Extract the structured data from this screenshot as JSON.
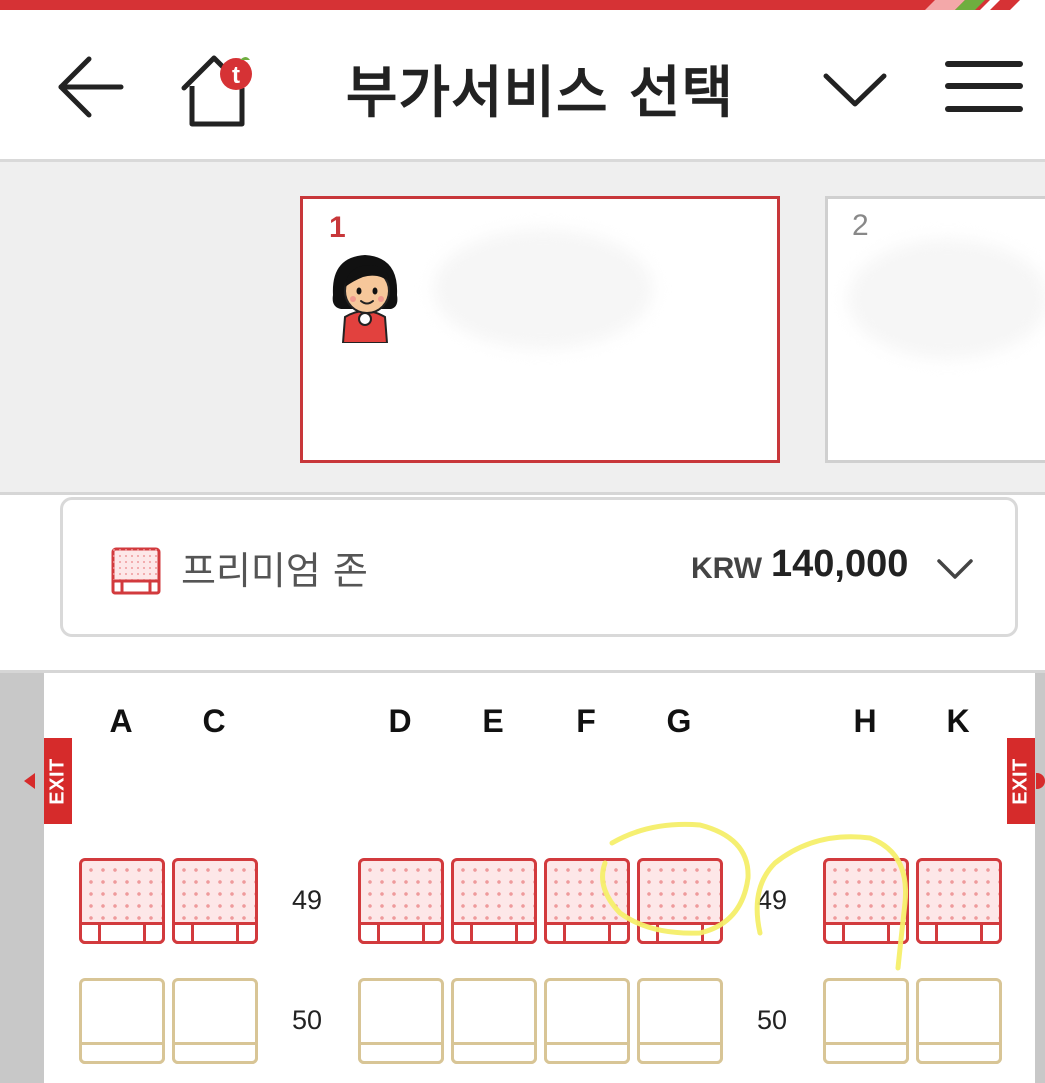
{
  "header": {
    "title": "부가서비스 선택",
    "back_icon": "arrow-left-icon",
    "home_icon": "home-icon",
    "dropdown_icon": "chevron-down-icon",
    "menu_icon": "hamburger-menu-icon"
  },
  "passengers": [
    {
      "number": "1",
      "selected": true,
      "avatar": "female-passenger-avatar"
    },
    {
      "number": "2",
      "selected": false
    }
  ],
  "zone": {
    "label": "프리미엄 존",
    "currency": "KRW",
    "price": "140,000",
    "icon": "premium-seat-icon"
  },
  "seatmap": {
    "columns": [
      "A",
      "C",
      "D",
      "E",
      "F",
      "G",
      "H",
      "K"
    ],
    "exit_label": "EXIT",
    "rows": [
      {
        "number": "49",
        "type": "premium"
      },
      {
        "number": "50",
        "type": "standard"
      }
    ]
  },
  "colors": {
    "brand_red": "#c8373a",
    "premium_seat": "#d23a3d",
    "standard_seat": "#d8c596",
    "exit_sign": "#d62b2b",
    "highlight": "#f5ef6a"
  }
}
